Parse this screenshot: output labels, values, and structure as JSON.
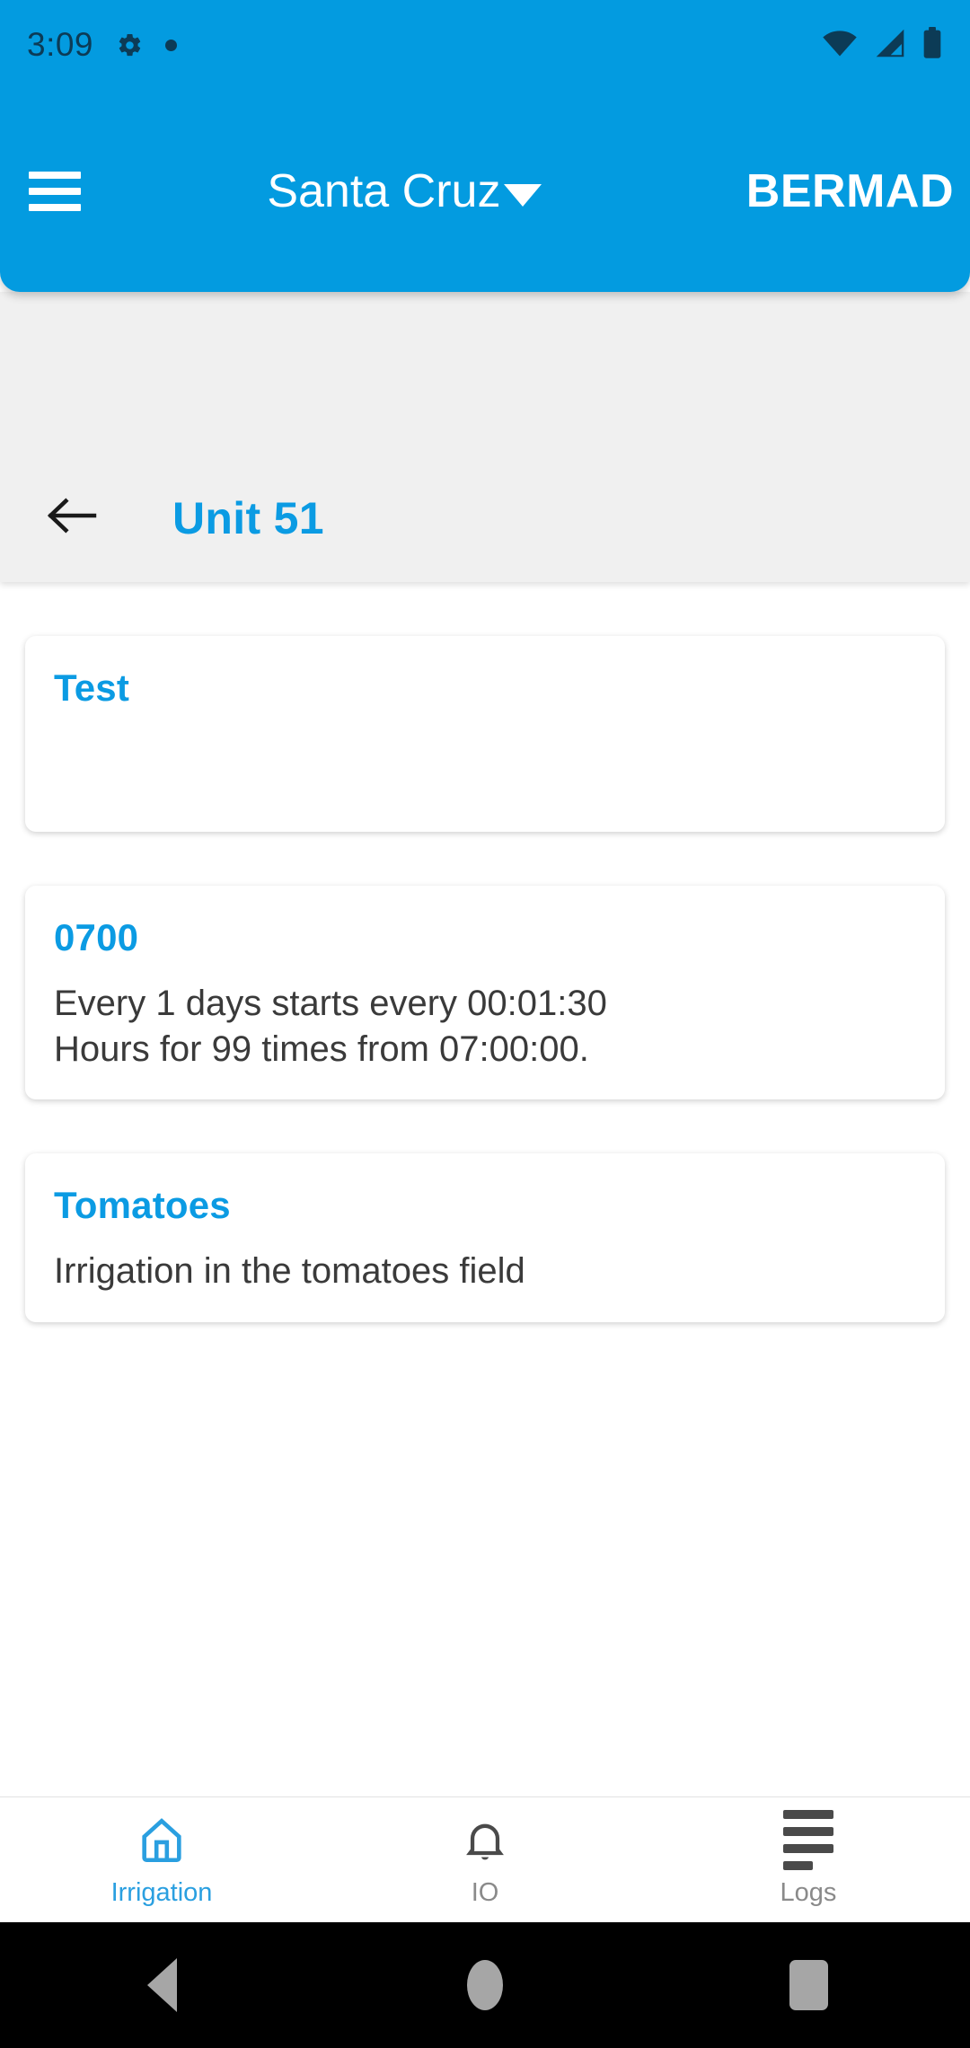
{
  "status_bar": {
    "time": "3:09",
    "icons": [
      "gear-icon",
      "dot-indicator",
      "wifi-icon",
      "cellular-signal-icon",
      "battery-icon"
    ]
  },
  "app_bar": {
    "menu_icon": "hamburger-menu-icon",
    "location": "Santa Cruz",
    "dropdown_icon": "chevron-down-icon",
    "brand": "BERMAD",
    "background_color": "#039BE0"
  },
  "sub_header": {
    "back_icon": "arrow-left-icon",
    "title": "Unit 51",
    "title_color": "#0B9BE3",
    "background_color": "#F0F0F0"
  },
  "cards": [
    {
      "title": "Test",
      "body": ""
    },
    {
      "title": "0700",
      "body": "Every 1 days starts every 00:01:30\nHours for 99 times from 07:00:00."
    },
    {
      "title": "Tomatoes",
      "body": "Irrigation in the tomatoes field"
    }
  ],
  "bottom_nav": {
    "active_color": "#2A9FE0",
    "inactive_color": "#8A8A8A",
    "items": [
      {
        "label": "Irrigation",
        "icon": "home-icon",
        "active": true
      },
      {
        "label": "IO",
        "icon": "bell-icon",
        "active": false
      },
      {
        "label": "Logs",
        "icon": "list-lines-icon",
        "active": false
      }
    ]
  },
  "system_nav": {
    "back": "triangle-back-icon",
    "home": "circle-home-icon",
    "recents": "square-recents-icon"
  }
}
